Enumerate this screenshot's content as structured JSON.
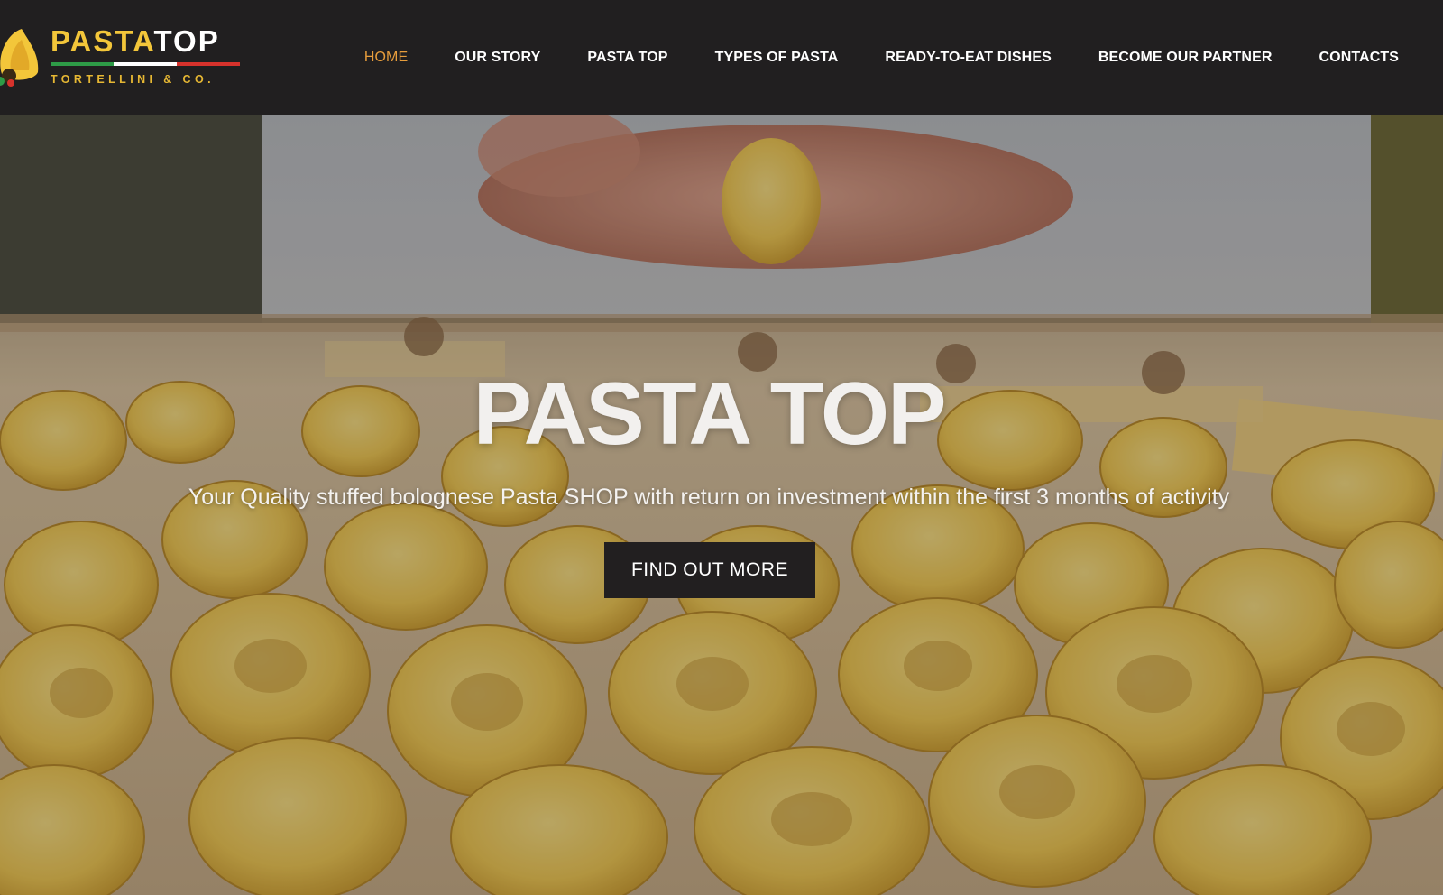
{
  "brand": {
    "name_part1": "PASTA",
    "name_part2": "TOP",
    "tagline": "TORTELLINI & CO.",
    "colors": {
      "gold": "#f3c63a",
      "green": "#2e9b47",
      "white": "#ffffff",
      "red": "#d6322c"
    }
  },
  "nav": {
    "items": [
      {
        "label": "HOME",
        "active": true
      },
      {
        "label": "OUR STORY",
        "active": false
      },
      {
        "label": "PASTA TOP",
        "active": false
      },
      {
        "label": "TYPES OF PASTA",
        "active": false
      },
      {
        "label": "READY-TO-EAT DISHES",
        "active": false
      },
      {
        "label": "BECOME OUR PARTNER",
        "active": false
      },
      {
        "label": "CONTACTS",
        "active": false
      }
    ],
    "colors": {
      "active": "#e79d3c",
      "default": "#ffffff",
      "background": "#211f20"
    }
  },
  "hero": {
    "title": "PASTA TOP",
    "subtitle": "Your Quality stuffed bolognese Pasta SHOP with return on investment within the first 3 months of activity",
    "cta_label": "FIND OUT MORE"
  }
}
